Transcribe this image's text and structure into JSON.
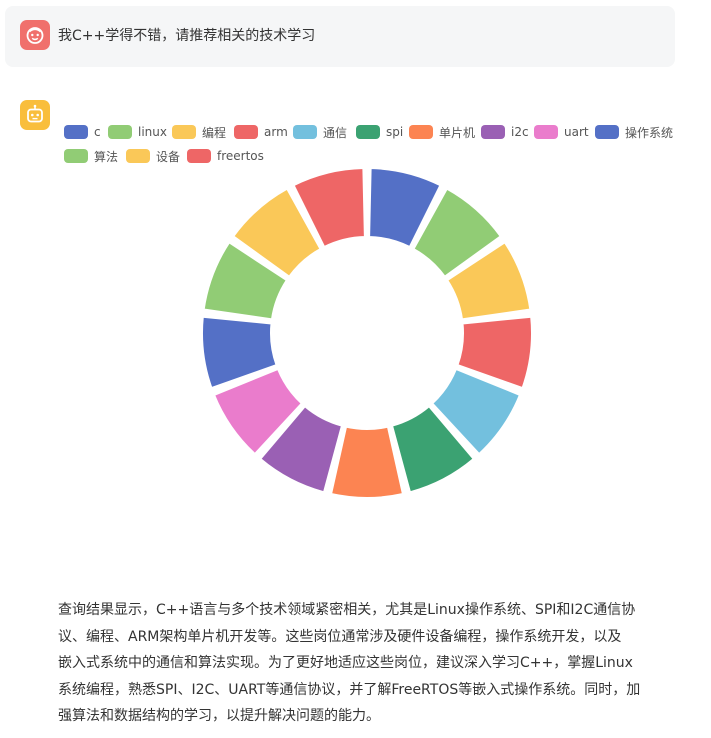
{
  "user_message": {
    "text": "我C++学得不错，请推荐相关的技术学习"
  },
  "colors": {
    "user_avatar": "#f0706c",
    "bot_avatar": "#f9be3c",
    "bubble_bg": "#f5f6f7"
  },
  "icons": {
    "user": "smiley-face-icon",
    "bot": "robot-icon"
  },
  "chart_data": {
    "type": "pie",
    "variant": "donut",
    "legend_position": "top",
    "slices": [
      {
        "label": "c",
        "value": 1,
        "color": "#5470c6"
      },
      {
        "label": "linux",
        "value": 1,
        "color": "#91cc75"
      },
      {
        "label": "编程",
        "value": 1,
        "color": "#fac858"
      },
      {
        "label": "arm",
        "value": 1,
        "color": "#ee6666"
      },
      {
        "label": "通信",
        "value": 1,
        "color": "#73c0de"
      },
      {
        "label": "spi",
        "value": 1,
        "color": "#3ba272"
      },
      {
        "label": "单片机",
        "value": 1,
        "color": "#fc8452"
      },
      {
        "label": "i2c",
        "value": 1,
        "color": "#9a60b4"
      },
      {
        "label": "uart",
        "value": 1,
        "color": "#ea7ccc"
      },
      {
        "label": "操作系统",
        "value": 1,
        "color": "#5470c6"
      },
      {
        "label": "算法",
        "value": 1,
        "color": "#91cc75"
      },
      {
        "label": "设备",
        "value": 1,
        "color": "#fac858"
      },
      {
        "label": "freertos",
        "value": 1,
        "color": "#ee6666"
      }
    ]
  },
  "answer": {
    "lines": [
      "查询结果显示，C++语言与多个技术领域紧密相关，尤其是Linux操作系统、SPI和I2C通信协",
      "议、编程、ARM架构单片机开发等。这些岗位通常涉及硬件设备编程，操作系统开发，以及",
      "嵌入式系统中的通信和算法实现。为了更好地适应这些岗位，建议深入学习C++，掌握Linux",
      "系统编程，熟悉SPI、I2C、UART等通信协议，并了解FreeRTOS等嵌入式操作系统。同时，加",
      "强算法和数据结构的学习，以提升解决问题的能力。"
    ]
  }
}
